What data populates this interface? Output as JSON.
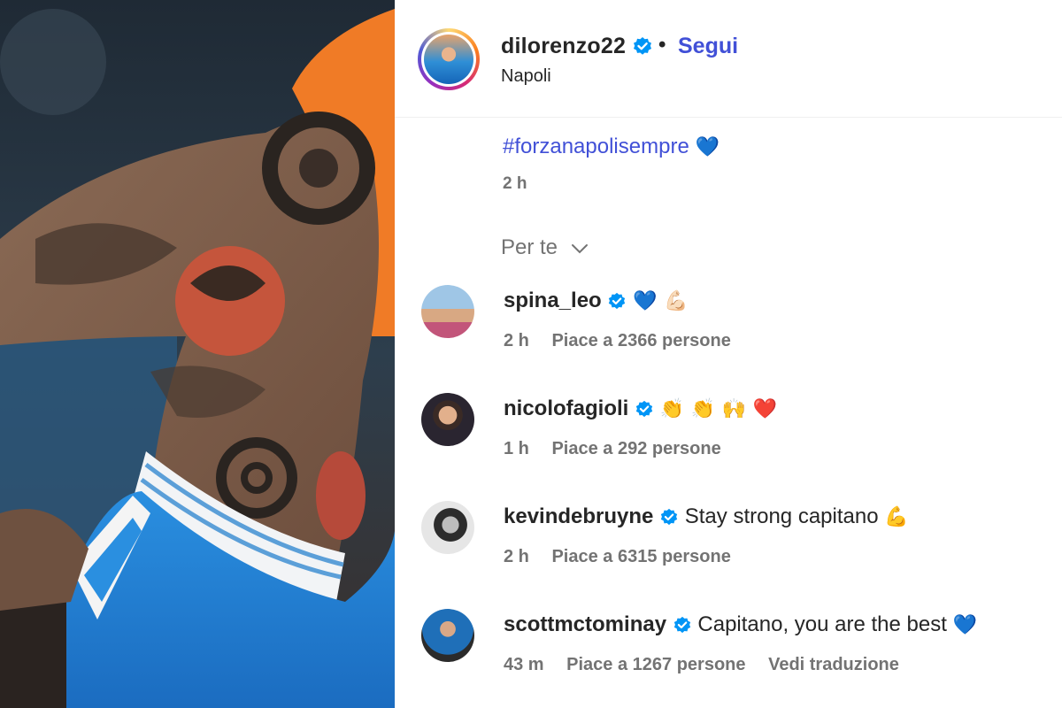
{
  "post": {
    "username": "dilorenzo22",
    "follow_label": "Segui",
    "separator": "•",
    "location": "Napoli",
    "caption_hashtag": "#forzanapolisempre",
    "caption_emoji": "💙",
    "time": "2 h"
  },
  "comments_filter": {
    "label": "Per te",
    "icon": "chevron-down-icon"
  },
  "comments": [
    {
      "username": "spina_leo",
      "verified": true,
      "text": "",
      "emoji": "💙 💪🏻",
      "time": "2 h",
      "likes": "Piace a 2366 persone",
      "extra": ""
    },
    {
      "username": "nicolofagioli",
      "verified": true,
      "text": "",
      "emoji": "👏 👏 🙌 ❤️",
      "time": "1 h",
      "likes": "Piace a 292 persone",
      "extra": ""
    },
    {
      "username": "kevindebruyne",
      "verified": true,
      "text": "Stay strong capitano",
      "emoji": "💪",
      "time": "2 h",
      "likes": "Piace a 6315 persone",
      "extra": ""
    },
    {
      "username": "scottmctominay",
      "verified": true,
      "text": "Capitano, you are the best",
      "emoji": "💙",
      "time": "43 m",
      "likes": "Piace a 1267 persone",
      "extra": "Vedi traduzione"
    }
  ],
  "colors": {
    "link": "#4150d7",
    "verified": "#0095f6",
    "muted": "#737373",
    "text": "#262626"
  }
}
